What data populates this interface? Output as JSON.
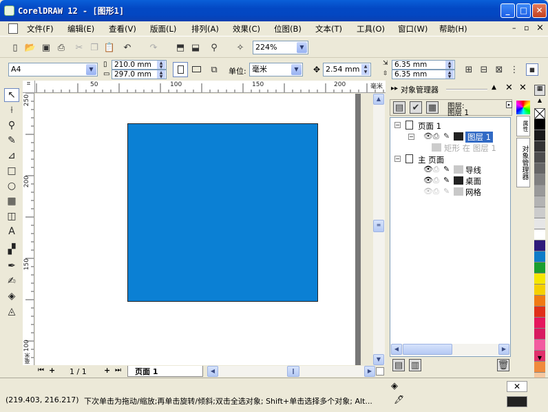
{
  "window": {
    "title": "CorelDRAW 12 - [图形1]",
    "btn_min": "_",
    "btn_max": "□",
    "btn_close": "✕"
  },
  "menu": [
    "文件(F)",
    "编辑(E)",
    "查看(V)",
    "版面(L)",
    "排列(A)",
    "效果(C)",
    "位图(B)",
    "文本(T)",
    "工具(O)",
    "窗口(W)",
    "帮助(H)"
  ],
  "mdi": {
    "min": "–",
    "restore": "▫",
    "close": "×"
  },
  "toolbar": {
    "zoom": "224%"
  },
  "propbar": {
    "page_size": "A4",
    "width": "210.0 mm",
    "height": "297.0 mm",
    "unit_label": "单位:",
    "unit": "毫米",
    "nudge": "2.54 mm",
    "dup_x": "6.35 mm",
    "dup_y": "6.35 mm"
  },
  "ruler_h": [
    "50",
    "100",
    "150",
    "200",
    "毫米"
  ],
  "ruler_v": [
    "250",
    "200",
    "150",
    "100",
    "毫米"
  ],
  "page_nav": {
    "counter": "1 / 1",
    "tab": "页面 1"
  },
  "docker": {
    "title": "对象管理器",
    "info_l1": "图层:",
    "info_l2": "图层 1",
    "side_tabs": [
      "对象管理器"
    ],
    "tree": {
      "page1": "页面 1",
      "layer1": "图层 1",
      "rect_item": "矩形 在 图层 1",
      "master": "主 页面",
      "guides": "导线",
      "desktop": "桌面",
      "grid": "网格"
    }
  },
  "status": {
    "coords": "(219.403, 216.217)",
    "hint": "下次单击为拖动/缩放;再单击旋转/倾斜;双击全选对象; Shift+单击选择多个对象; Alt..."
  },
  "colors": {
    "rect_fill": "#0b80d4"
  },
  "palette": [
    "#ffffff",
    "#000000",
    "#1a1a1a",
    "#333333",
    "#4d4d4d",
    "#666666",
    "#808080",
    "#999999",
    "#b3b3b3",
    "#cccccc",
    "#e6e6e6",
    "#ffffff",
    "#2e1a7a",
    "#0e7cc8",
    "#1a9e2e",
    "#f5e600",
    "#f5d000",
    "#f07a14",
    "#e0301a",
    "#e5175d",
    "#d81b60",
    "#f25ca0",
    "#e0306a",
    "#f08a3c",
    "#f5c8a0"
  ]
}
